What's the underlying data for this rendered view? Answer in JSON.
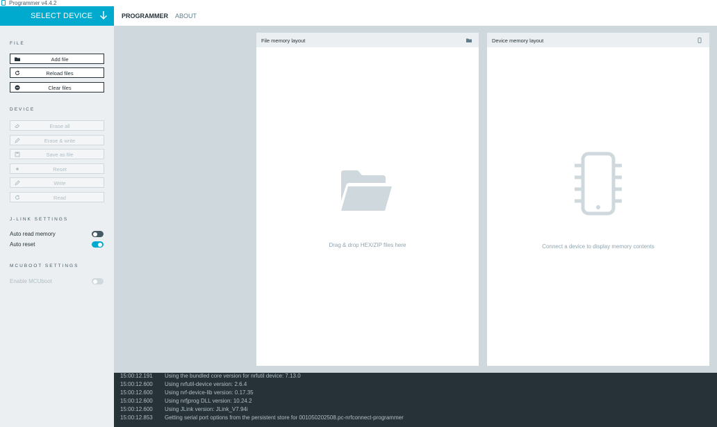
{
  "window": {
    "title": "Programmer v4.4.2"
  },
  "nav": {
    "select_device": "SELECT DEVICE",
    "tabs": [
      {
        "label": "PROGRAMMER",
        "active": true
      },
      {
        "label": "ABOUT",
        "active": false
      }
    ]
  },
  "sidebar": {
    "file": {
      "title": "FILE",
      "buttons": [
        {
          "label": "Add file",
          "icon": "folder-icon",
          "enabled": true
        },
        {
          "label": "Reload files",
          "icon": "reload-icon",
          "enabled": true
        },
        {
          "label": "Clear files",
          "icon": "minus-circle-icon",
          "enabled": true
        }
      ]
    },
    "device": {
      "title": "DEVICE",
      "buttons": [
        {
          "label": "Erase all",
          "icon": "eraser-icon",
          "enabled": false
        },
        {
          "label": "Erase & write",
          "icon": "pencil-icon",
          "enabled": false
        },
        {
          "label": "Save as file",
          "icon": "save-icon",
          "enabled": false
        },
        {
          "label": "Reset",
          "icon": "record-icon",
          "enabled": false
        },
        {
          "label": "Write",
          "icon": "pencil-icon",
          "enabled": false
        },
        {
          "label": "Read",
          "icon": "reload-icon",
          "enabled": false
        }
      ]
    },
    "jlink": {
      "title": "J-LINK SETTINGS",
      "toggles": [
        {
          "label": "Auto read memory",
          "on": false
        },
        {
          "label": "Auto reset",
          "on": true
        }
      ]
    },
    "mcuboot": {
      "title": "MCUBOOT SETTINGS",
      "toggles": [
        {
          "label": "Enable MCUboot",
          "on": false,
          "enabled": false
        }
      ]
    }
  },
  "panels": {
    "file": {
      "title": "File memory layout",
      "message": "Drag & drop HEX/ZIP files here",
      "icon": "folder-icon"
    },
    "device": {
      "title": "Device memory layout",
      "message": "Connect a device to display memory contents",
      "icon": "chip-icon"
    }
  },
  "log": [
    {
      "ts": "15:00:12.191",
      "msg": "Using the bundled core version for nrfutil device: 7.13.0"
    },
    {
      "ts": "15:00:12.600",
      "msg": "Using nrfutil-device version: 2.6.4"
    },
    {
      "ts": "15:00:12.600",
      "msg": "Using nrf-device-lib version: 0.17.35"
    },
    {
      "ts": "15:00:12.600",
      "msg": "Using nrfjprog DLL version: 10.24.2"
    },
    {
      "ts": "15:00:12.600",
      "msg": "Using JLink version: JLink_V7.94i"
    },
    {
      "ts": "15:00:12.853",
      "msg": "Getting serial port options from the persistent store for 001050202508.pc-nrfconnect-programmer"
    }
  ],
  "colors": {
    "accent": "#00a9ce",
    "sidebar_bg": "#eceff1",
    "canvas_bg": "#cfd8dc",
    "log_bg": "#263238"
  }
}
